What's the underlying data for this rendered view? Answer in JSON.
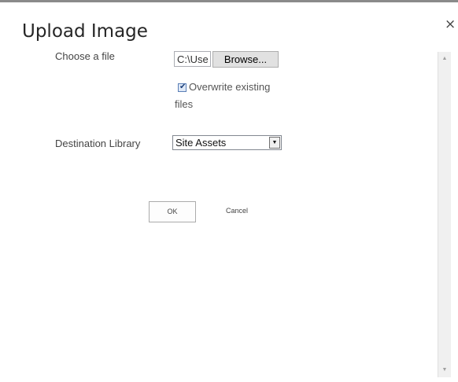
{
  "dialog": {
    "title": "Upload Image",
    "close_glyph": "×"
  },
  "form": {
    "choose_file_label": "Choose a file",
    "file_path_value": "C:\\Use",
    "browse_label": "Browse...",
    "overwrite_checked": true,
    "overwrite_label_line1": "Overwrite existing",
    "overwrite_label_line2": "files",
    "destination_label": "Destination Library",
    "destination_selected": "Site Assets"
  },
  "actions": {
    "ok_label": "OK",
    "cancel_label": "Cancel"
  },
  "icons": {
    "close": "close-icon",
    "checkbox_check": "checkmark-icon",
    "dropdown_arrow": "chevron-down-icon",
    "scroll_up": "scroll-up-arrow-icon",
    "scroll_down": "scroll-down-arrow-icon"
  },
  "colors": {
    "title_text": "#262626",
    "label_text": "#444444",
    "checkbox_fill": "#dfe9f7",
    "checkbox_border": "#5b7fb6"
  }
}
